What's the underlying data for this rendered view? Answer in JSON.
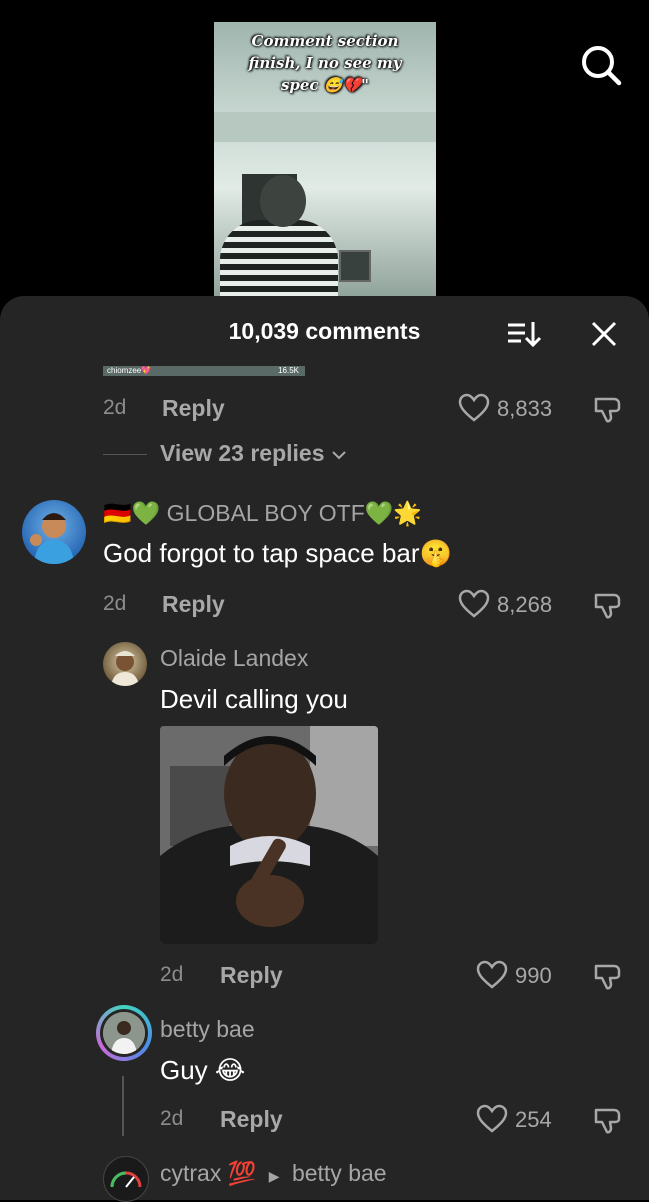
{
  "video": {
    "caption_line0": "Comment section",
    "caption_line1": "finish, I no see my",
    "caption_line2": "spec 😅💔\""
  },
  "header": {
    "comment_count": "10,039 comments"
  },
  "top_thread": {
    "strip_user": "chiomzee💖",
    "strip_count": "16.5K",
    "time": "2d",
    "reply": "Reply",
    "likes": "8,833",
    "view_replies": "View 23 replies"
  },
  "comments": [
    {
      "username": "🇩🇪💚 GLOBAL BOY OTF💚🌟",
      "text": "God forgot to tap space bar🤫",
      "time": "2d",
      "reply": "Reply",
      "likes": "8,268"
    },
    {
      "username": "Olaide Landex",
      "text": "Devil calling you",
      "time": "2d",
      "reply": "Reply",
      "likes": "990"
    },
    {
      "username": "betty bae",
      "text": "Guy 😂",
      "time": "2d",
      "reply": "Reply",
      "likes": "254"
    },
    {
      "username": "cytrax 💯",
      "reply_to": "betty bae"
    }
  ],
  "colors": {
    "background": "#000000",
    "sheet": "#252525",
    "muted_text": "#a8a8a8"
  }
}
